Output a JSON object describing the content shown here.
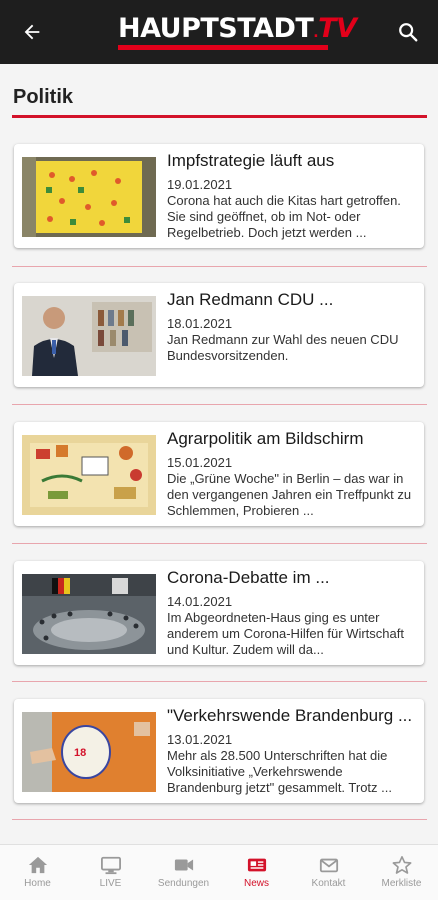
{
  "header": {
    "logo_main": "HAUPTSTADT",
    "logo_dot": ".",
    "logo_tv": "TV",
    "back_icon": "arrow-left-icon",
    "search_icon": "search-icon"
  },
  "section": {
    "title": "Politik"
  },
  "articles": [
    {
      "title": "Impfstrategie läuft aus",
      "date": "19.01.2021",
      "teaser": "Corona hat auch die Kitas hart getroffen. Sie sind geöffnet, ob im Not- oder Regelbetrieb. Doch jetzt werden ..."
    },
    {
      "title": "Jan Redmann CDU ...",
      "date": "18.01.2021",
      "teaser": "Jan Redmann zur Wahl des neuen CDU Bundesvorsitzenden."
    },
    {
      "title": "Agrarpolitik am Bildschirm",
      "date": "15.01.2021",
      "teaser": "Die „Grüne Woche\" in Berlin – das war in den vergangenen Jahren ein Treffpunkt zu Schlemmen, Probieren ..."
    },
    {
      "title": "Corona-Debatte im ...",
      "date": "14.01.2021",
      "teaser": "Im Abgeordneten-Haus ging es unter anderem um Corona-Hilfen für Wirtschaft und Kultur. Zudem will da..."
    },
    {
      "title": "\"Verkehrswende Brandenburg ...",
      "date": "13.01.2021",
      "teaser": "Mehr als 28.500 Unterschriften hat die Volksinitiative „Verkehrswende Brandenburg jetzt\" gesammelt. Trotz ..."
    }
  ],
  "bottom_nav": {
    "active": "News",
    "items": [
      {
        "label": "Home",
        "icon": "home-icon"
      },
      {
        "label": "LIVE",
        "icon": "monitor-icon"
      },
      {
        "label": "Sendungen",
        "icon": "video-camera-icon"
      },
      {
        "label": "News",
        "icon": "newspaper-icon"
      },
      {
        "label": "Kontakt",
        "icon": "mail-icon"
      },
      {
        "label": "Merkliste",
        "icon": "star-icon"
      }
    ]
  },
  "colors": {
    "brand_red": "#d3122a",
    "topbar": "#1e1e1e",
    "inactive_nav": "#9a9a9a"
  }
}
